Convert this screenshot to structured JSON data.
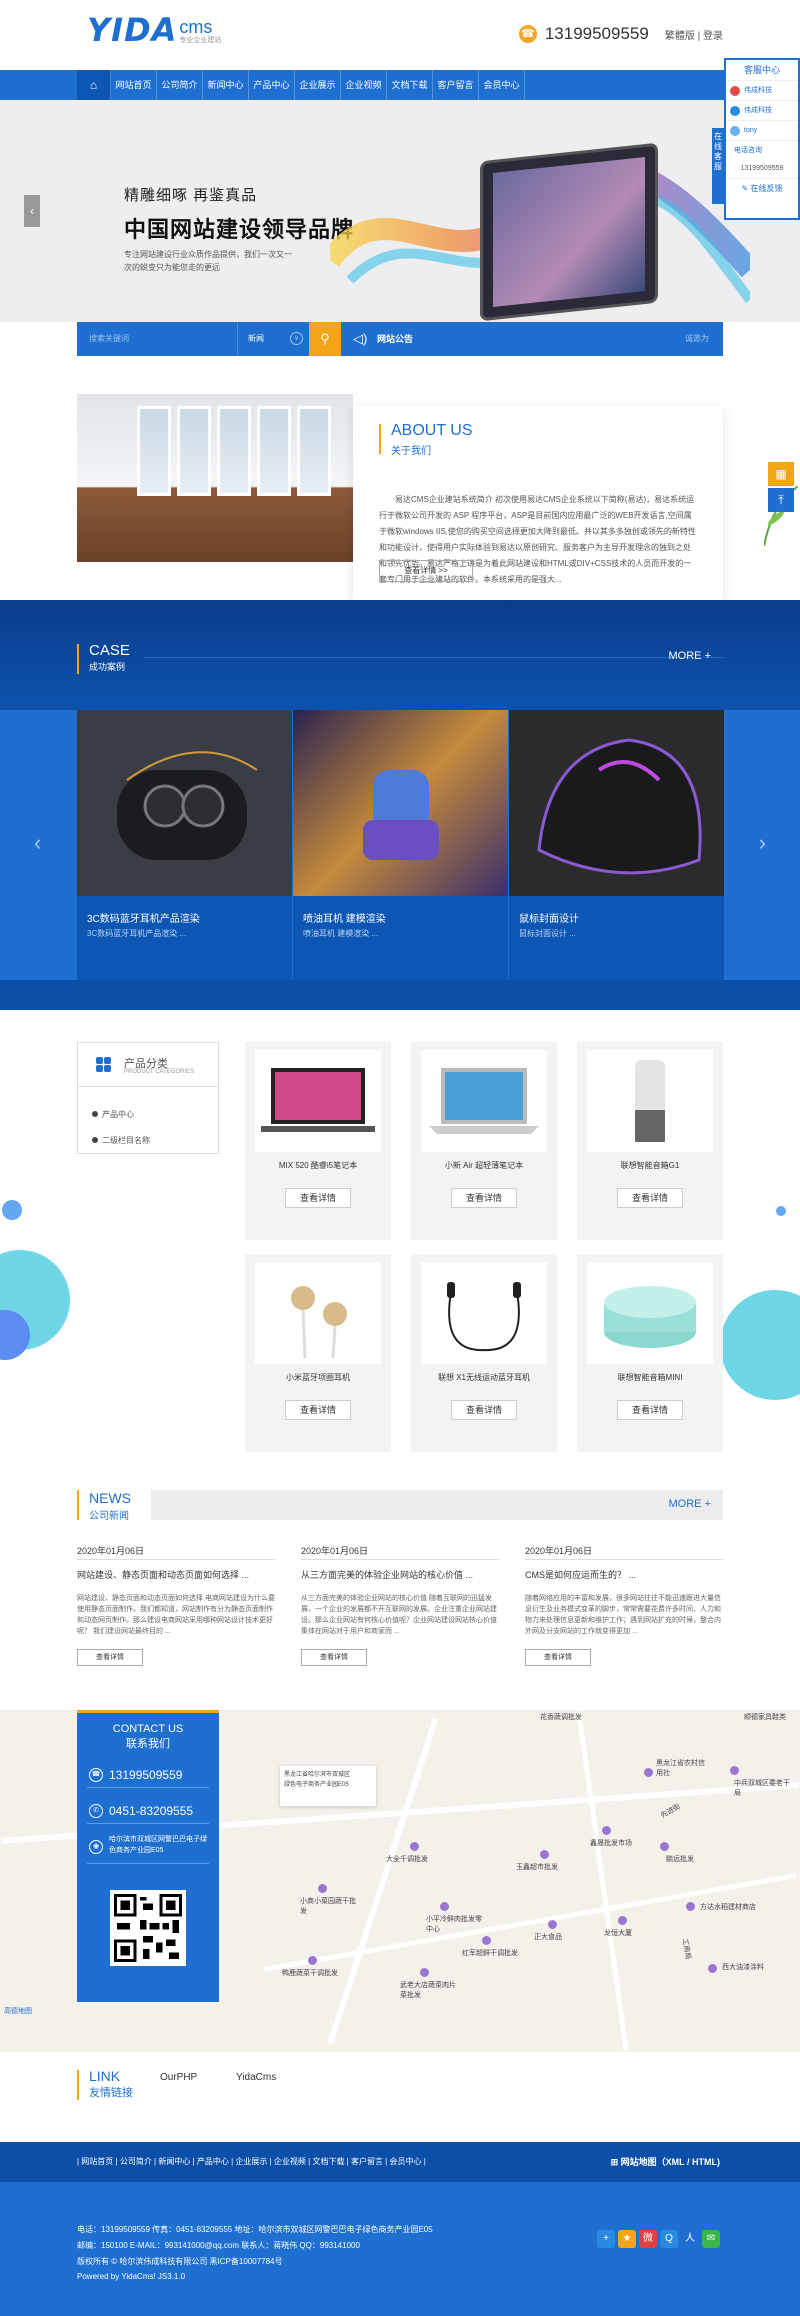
{
  "header": {
    "logo_main": "YIDA",
    "logo_cms": "cms",
    "logo_tagline": "专业企业建站",
    "phone": "13199509559",
    "lang": "繁體版 | 登录"
  },
  "nav": {
    "home_icon": "home-icon",
    "items": [
      "网站首页",
      "公司简介",
      "新闻中心",
      "产品中心",
      "企业展示",
      "企业视频",
      "文档下载",
      "客户留言",
      "会员中心"
    ]
  },
  "banner": {
    "line1": "精雕细啄 再鉴真品",
    "line2": "中国网站建设领导品牌",
    "line3": "专注网站建设行业众质作品提供，我们一次又一次的蜕变只为能您走的更远",
    "arrow": "‹"
  },
  "search": {
    "placeholder": "搜索关键词",
    "select_value": "新闻",
    "notice_label": "网站公告",
    "notice_right": "诚邀为"
  },
  "about": {
    "title_en": "ABOUT US",
    "title_cn": "关于我们",
    "desc": "易达CMS企业建站系统简介 初次使用易达CMS企业系统以下简称(易达)，易达系统运行于微软公司开发的 ASP 程序平台，ASP是目前国内应用最广泛的WEB开发语言,空间属于微软windows IIS,使您的购买空间选择更加大降到最低。并以其多多独创或领先的新特性和功能设计，使得用户实际体验到易达以原创研究、服务客户为主导开发理念的独到之处和领先优势。易达严格上讲是为着此网站建设和HTML或DIV+CSS技术的人员而开发的一套专门用于企业建站的软件。本系统采用的是强大...",
    "button": "查看详情 >>"
  },
  "case": {
    "title_en": "CASE",
    "title_cn": "成功案例",
    "more": "MORE +",
    "items": [
      {
        "title": "3C数码蓝牙耳机产品渲染",
        "sub": "3C数码蓝牙耳机产品渲染 ..."
      },
      {
        "title": "喷油耳机 建模渲染",
        "sub": "喷油耳机 建模渲染 ..."
      },
      {
        "title": "鼠标封面设计",
        "sub": "鼠标封面设计 ..."
      }
    ]
  },
  "products": {
    "cat_title": "产品分类",
    "cat_title_en": "PRODUCT CATEGORIES",
    "cat_items": [
      "产品中心",
      "二级栏目名称"
    ],
    "button": "查看详情",
    "items": [
      {
        "name": "MIX 520 酷睿i5笔记本"
      },
      {
        "name": "小新 Air 超轻薄笔记本"
      },
      {
        "name": "联想智能音箱G1"
      },
      {
        "name": "小米蓝牙项圈耳机"
      },
      {
        "name": "联想 X1无线运动蓝牙耳机"
      },
      {
        "name": "联想智能音箱MINI"
      }
    ]
  },
  "news": {
    "title_en": "NEWS",
    "title_cn": "公司新闻",
    "more": "MORE +",
    "button": "查看详情",
    "items": [
      {
        "date": "2020年01月06日",
        "title": "网站建设、静态页面和动态页面如何选择 ...",
        "desc": "网站建设、静态页面和动态页面如何选择 电商网站建设为什么要使用静态页面制作。我们都知道，网站制作有分为静态页面制作和动态网页制作。那么建设电商网站采用哪种网站设计技术更好呢？ 我们建设网站最终目的 ..."
      },
      {
        "date": "2020年01月06日",
        "title": "从三方面完美的体验企业网站的核心价值 ...",
        "desc": "从三方面完美的体验企业网站的核心价值 随着互联网的迅猛发展，一个企业的发展都不开互联网的发展。企业注重企业网站建设。那么企业网站有何核心价值呢？企业网站建设网站核心价值集体在网站对于用户和商家而 ..."
      },
      {
        "date": "2020年01月06日",
        "title": "CMS是如何应运而生的？ ...",
        "desc": "随着网络应用的丰富和发展，很多网站往往不能迅速跟进大量信息衍生及业务模式变革的脚步，常常需要花费许多时间、人力和物力来处理信息更新和维护工作；遇到网站扩充的时候，整合内外网及分支网站的工作就变得更加 ..."
      }
    ]
  },
  "contact": {
    "title_cn": "CONTACT US",
    "title_cn2": "联系我们",
    "phone": "13199509559",
    "tel": "0451-83209555",
    "address": "哈尔滨市双城区网警巴巴电子绿色商务产业园E05",
    "map_popup_line1": "黑龙江省哈尔滨市双城区",
    "map_popup_line2": "绿色电子商务产业园E05",
    "map_labels": [
      "大全千调批发",
      "玉鑫超市批发",
      "鑫晟批发市场",
      "正大食品",
      "龙恒大厦",
      "黑龙江省农村信用社",
      "中兵双城区委老干局",
      "方达水稻建材商店",
      "小商小菜园蔬干批发",
      "小平冷鲜肉批发零中心",
      "红军超鲜干调批发",
      "武老大店蔬菜肉片 菜批发",
      "顺德家具鞋类",
      "鸭鹿蔬菜干调批发",
      "西大油漆涂料",
      "花香蔬调批发",
      "先进街",
      "鹏远批发",
      "工商局"
    ],
    "map_nav": "高德地图"
  },
  "links": {
    "title_en": "LINK",
    "title_cn": "友情链接",
    "items": [
      "OurPHP",
      "YidaCms"
    ]
  },
  "footer": {
    "nav": "| 网站首页 | 公司简介 | 新闻中心 | 产品中心 | 企业展示 | 企业视频 | 文档下载 | 客户留言 | 会员中心 |",
    "sitemap": "网站地图（XML / HTML)",
    "line1": "电话：13199509559    传真：0451-83209555    地址：哈尔滨市双城区网警巴巴电子绿色商务产业园E05",
    "line2": "邮编：150100    E-MAIL：993141000@qq.com    联系人：蒋晓伟    QQ：993141000",
    "line3": "版权所有 © 哈尔滨伟成科技有限公司    黑ICP备10007784号",
    "line4": "Powered by YidaCms! JS3.1.0"
  },
  "service": {
    "title": "客服中心",
    "tab": "在线客服",
    "agents": [
      "伟成科技",
      "伟成科技",
      "tony"
    ],
    "phone_label": "电话咨询",
    "phone": "13199509559",
    "message": "在线反馈"
  }
}
